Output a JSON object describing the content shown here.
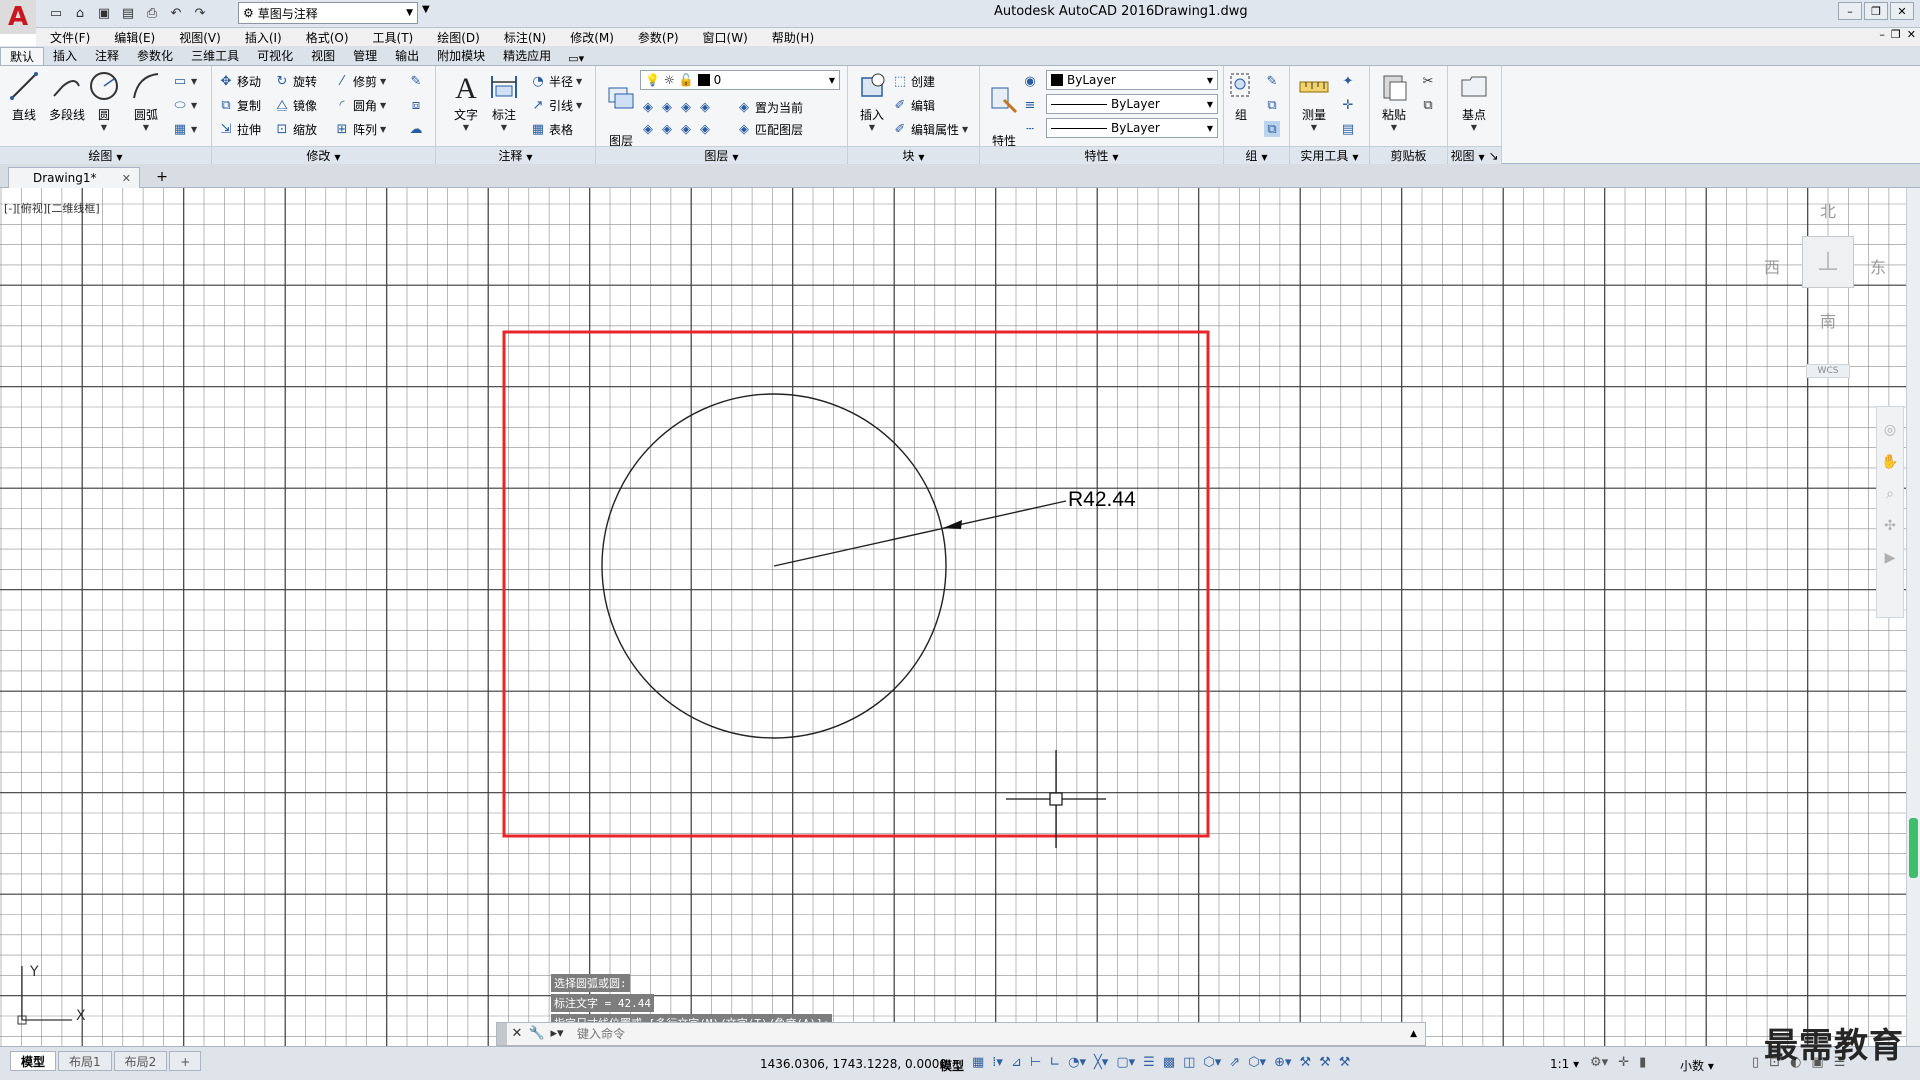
{
  "titlebar": {
    "workspace": "草图与注释",
    "app_title": "Autodesk AutoCAD 2016",
    "doc_title": "Drawing1.dwg"
  },
  "menu": [
    "文件(F)",
    "编辑(E)",
    "视图(V)",
    "插入(I)",
    "格式(O)",
    "工具(T)",
    "绘图(D)",
    "标注(N)",
    "修改(M)",
    "参数(P)",
    "窗口(W)",
    "帮助(H)"
  ],
  "ribbon_tabs": [
    "默认",
    "插入",
    "注释",
    "参数化",
    "三维工具",
    "可视化",
    "视图",
    "管理",
    "输出",
    "附加模块",
    "精选应用"
  ],
  "ribbon": {
    "draw": {
      "title": "绘图",
      "line": "直线",
      "polyline": "多段线",
      "circle": "圆",
      "arc": "圆弧"
    },
    "modify": {
      "title": "修改",
      "move": "移动",
      "rotate": "旋转",
      "trim": "修剪",
      "copy": "复制",
      "mirror": "镜像",
      "fillet": "圆角",
      "stretch": "拉伸",
      "scale": "缩放",
      "array": "阵列"
    },
    "annotation": {
      "title": "注释",
      "text": "文字",
      "dimension": "标注",
      "radius": "半径",
      "leader": "引线",
      "table": "表格"
    },
    "layers": {
      "title": "图层",
      "layer_props": "图层\n特性",
      "layer_value": "0",
      "set_current": "置为当前",
      "match_layer": "匹配图层"
    },
    "block": {
      "title": "块",
      "insert": "插入",
      "create": "创建",
      "edit": "编辑",
      "edit_attr": "编辑属性"
    },
    "properties": {
      "title": "特性",
      "match": "特性\n匹配",
      "color": "ByLayer",
      "linetype": "ByLayer",
      "lineweight": "ByLayer"
    },
    "groups": {
      "title": "组",
      "group": "组"
    },
    "utilities": {
      "title": "实用工具",
      "measure": "测量"
    },
    "clipboard": {
      "title": "剪贴板",
      "paste": "粘贴"
    },
    "view": {
      "title": "视图",
      "base": "基点"
    }
  },
  "file_tab": {
    "name": "Drawing1*"
  },
  "canvas": {
    "viewport_label": "[-][俯视][二维线框]",
    "dimension_text": "R42.44",
    "compass": {
      "north": "北",
      "south": "南",
      "east": "东",
      "west": "西"
    },
    "wcs": "WCS"
  },
  "ucs": {
    "x": "X",
    "y": "Y"
  },
  "command": {
    "history": [
      "选择圆弧或圆:",
      "标注文字 = 42.44",
      "指定尺寸线位置或 [多行文字(M)/文字(T)/角度(A)]:"
    ],
    "placeholder": "键入命令"
  },
  "status": {
    "layout_tabs": [
      "模型",
      "布局1",
      "布局2"
    ],
    "coords": "1436.0306, 1743.1228, 0.0000",
    "model": "模型",
    "scale": "1:1",
    "units": "小数"
  },
  "watermark": "最需教育",
  "colors": {
    "accent": "#c8171e",
    "selection_rect": "#e8262a",
    "grid_major": "#3a3a3a",
    "grid_minor": "#8c8c8c"
  }
}
